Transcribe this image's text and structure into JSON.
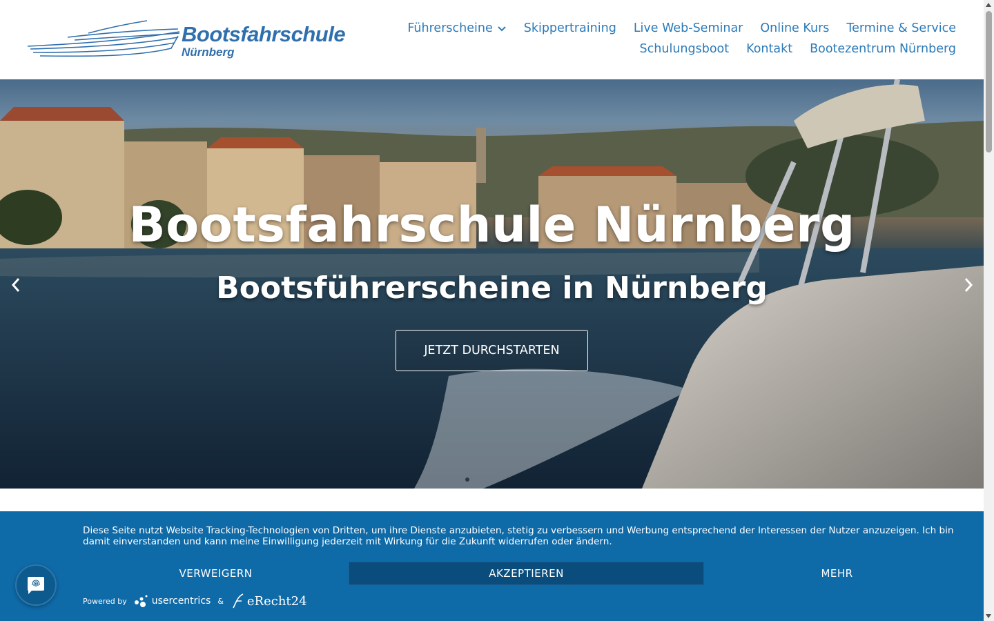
{
  "logo": {
    "title": "Bootsfahrschule",
    "subtitle": "Nürnberg"
  },
  "nav": {
    "row1": [
      {
        "label": "Führerscheine",
        "has_dropdown": true
      },
      {
        "label": "Skippertraining"
      },
      {
        "label": "Live Web-Seminar"
      },
      {
        "label": "Online Kurs"
      },
      {
        "label": "Termine & Service"
      }
    ],
    "row2": [
      {
        "label": "Schulungsboot"
      },
      {
        "label": "Kontakt"
      },
      {
        "label": "Bootezentrum Nürnberg"
      }
    ]
  },
  "hero": {
    "title": "Bootsfahrschule Nürnberg",
    "subtitle": "Bootsführerscheine in Nürnberg",
    "cta": "JETZT DURCHSTARTEN",
    "prev_icon": "chevron-left-icon",
    "next_icon": "chevron-right-icon"
  },
  "cookie": {
    "text": "Diese Seite nutzt Website Tracking-Technologien von Dritten, um ihre Dienste anzubieten, stetig zu verbessern und Werbung entsprechend der Interessen der Nutzer anzuzeigen. Ich bin damit einverstanden und kann meine Einwilligung jederzeit mit Wirkung für die Zukunft widerrufen oder ändern.",
    "deny": "VERWEIGERN",
    "accept": "AKZEPTIEREN",
    "more": "MEHR",
    "powered_by": "Powered by",
    "usercentrics": "usercentrics",
    "ampersand": "&",
    "erecht": "eRecht24"
  },
  "colors": {
    "brand_blue": "#2b7ab8",
    "cookie_bg": "#0f6aa8",
    "accept_bg": "#0a4c7c"
  }
}
